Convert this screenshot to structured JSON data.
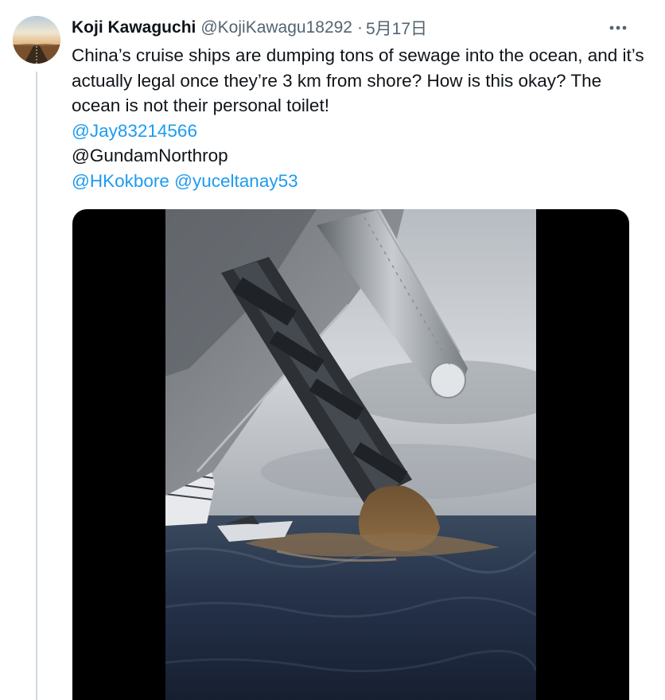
{
  "tweet": {
    "author": {
      "display_name": "Koji Kawaguchi",
      "handle": "@KojiKawagu18292",
      "avatar_icon": "landscape-road-avatar"
    },
    "separator": "·",
    "date": "5月17日",
    "more_icon": "more-horizontal-icon",
    "text": "China’s cruise ships are dumping tons of sewage into the ocean, and it’s actually legal once they’re 3 km from shore? How is this okay? The ocean is not their personal toilet!",
    "mentions": {
      "line1": "@Jay83214566",
      "line2": "@GundamNorthrop",
      "line3a": "@HKokbore",
      "line3b": "@yuceltanay53"
    },
    "colors": {
      "link": "#1d9bf0",
      "text": "#0f1419",
      "secondary": "#536471"
    }
  }
}
